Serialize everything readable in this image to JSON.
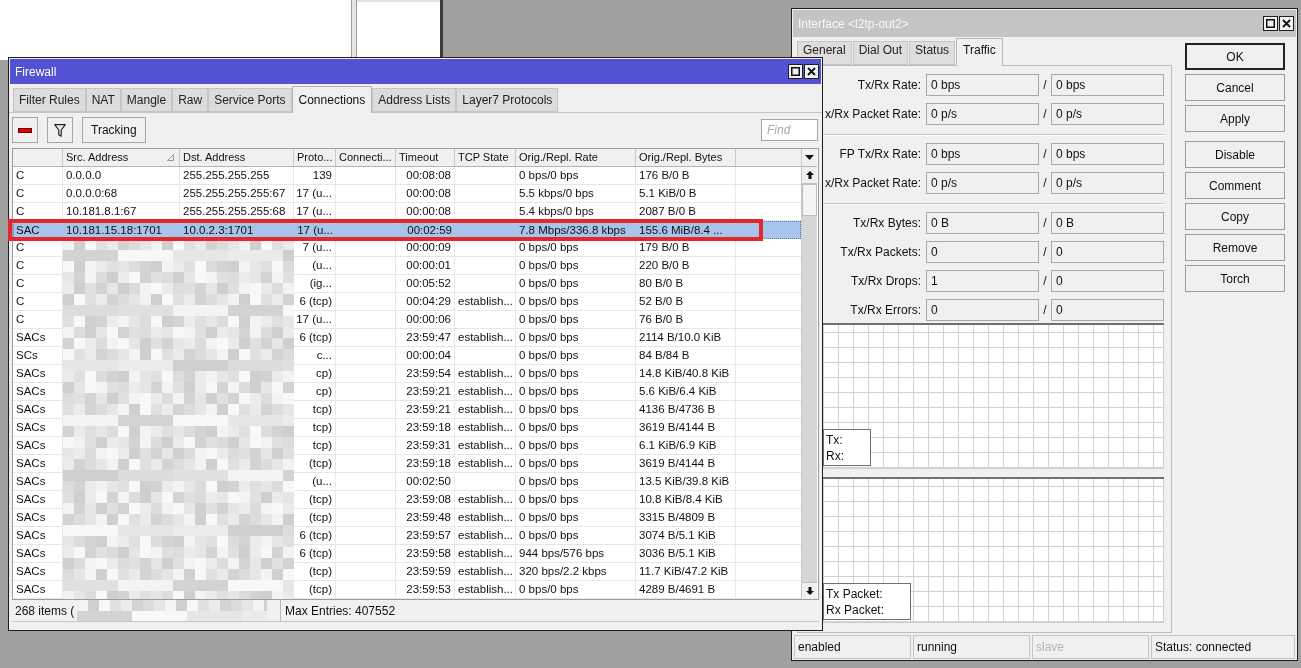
{
  "interface_window": {
    "title": "Interface <l2tp-out2>",
    "active": false,
    "tabs": [
      {
        "label": "General",
        "selected": false
      },
      {
        "label": "Dial Out",
        "selected": false
      },
      {
        "label": "Status",
        "selected": false
      },
      {
        "label": "Traffic",
        "selected": true
      }
    ],
    "field_groups": [
      [
        {
          "label": "Tx/Rx Rate:",
          "tx": "0 bps",
          "separator": "/",
          "rx": "0 bps"
        },
        {
          "label": "x/Rx Packet Rate:",
          "tx": "0 p/s",
          "separator": "/",
          "rx": "0 p/s"
        }
      ],
      [
        {
          "label": "FP Tx/Rx Rate:",
          "tx": "0 bps",
          "separator": "/",
          "rx": "0 bps"
        },
        {
          "label": "x/Rx Packet Rate:",
          "tx": "0 p/s",
          "separator": "/",
          "rx": "0 p/s"
        }
      ],
      [
        {
          "label": "Tx/Rx Bytes:",
          "tx": "0 B",
          "separator": "/",
          "rx": "0 B"
        },
        {
          "label": "Tx/Rx Packets:",
          "tx": "0",
          "separator": "/",
          "rx": "0"
        },
        {
          "label": "Tx/Rx Drops:",
          "tx": "1",
          "separator": "/",
          "rx": "0"
        },
        {
          "label": "Tx/Rx Errors:",
          "tx": "0",
          "separator": "/",
          "rx": "0"
        }
      ]
    ],
    "graphs": [
      {
        "legend": [
          "Tx:",
          "Rx:"
        ]
      },
      {
        "legend": [
          "Tx Packet:",
          "Rx Packet:"
        ]
      }
    ],
    "button_groups": [
      [
        {
          "label": "OK",
          "default": true
        },
        {
          "label": "Cancel",
          "default": false
        },
        {
          "label": "Apply",
          "default": false
        }
      ],
      [
        {
          "label": "Disable",
          "default": false
        },
        {
          "label": "Comment",
          "default": false
        },
        {
          "label": "Copy",
          "default": false
        },
        {
          "label": "Remove",
          "default": false
        },
        {
          "label": "Torch",
          "default": false
        }
      ]
    ],
    "status_bar": [
      {
        "text": "enabled",
        "disabled": false
      },
      {
        "text": "running",
        "disabled": false
      },
      {
        "text": "slave",
        "disabled": true
      },
      {
        "text": "Status: connected",
        "disabled": false
      }
    ]
  },
  "firewall_window": {
    "title": "Firewall",
    "active": true,
    "tabs": [
      {
        "label": "Filter Rules",
        "selected": false
      },
      {
        "label": "NAT",
        "selected": false
      },
      {
        "label": "Mangle",
        "selected": false
      },
      {
        "label": "Raw",
        "selected": false
      },
      {
        "label": "Service Ports",
        "selected": false
      },
      {
        "label": "Connections",
        "selected": true
      },
      {
        "label": "Address Lists",
        "selected": false
      },
      {
        "label": "Layer7 Protocols",
        "selected": false
      }
    ],
    "toolbar": {
      "buttons": [
        {
          "kind": "remove"
        },
        {
          "kind": "filter"
        },
        {
          "kind": "text",
          "label": "Tracking"
        }
      ],
      "find": {
        "placeholder": "Find"
      }
    },
    "table": {
      "columns": [
        {
          "label": "Src. Address",
          "sorted": true
        },
        {
          "label": "Dst. Address",
          "sorted": false
        },
        {
          "label": "Proto...",
          "sorted": false
        },
        {
          "label": "Connecti...",
          "sorted": false
        },
        {
          "label": "Timeout",
          "sorted": false
        },
        {
          "label": "TCP State",
          "sorted": false
        },
        {
          "label": "Orig./Repl. Rate",
          "sorted": false
        },
        {
          "label": "Orig./Repl. Bytes",
          "sorted": false
        }
      ],
      "rows": [
        {
          "flags": "C",
          "src_address": "0.0.0.0",
          "dst_address": "255.255.255.255",
          "protocol": "139",
          "timeout": "00:08:08",
          "rate": "0 bps/0 bps",
          "bytes": "176 B/0 B",
          "selected": false
        },
        {
          "flags": "C",
          "src_address": "0.0.0.0:68",
          "dst_address": "255.255.255.255:67",
          "protocol": "17 (u...",
          "timeout": "00:00:08",
          "rate": "5.5 kbps/0 bps",
          "bytes": "5.1 KiB/0 B",
          "selected": false
        },
        {
          "flags": "C",
          "src_address": "10.181.8.1:67",
          "dst_address": "255.255.255.255:68",
          "protocol": "17 (u...",
          "timeout": "00:00:08",
          "rate": "5.4 kbps/0 bps",
          "bytes": "2087 B/0 B",
          "selected": false
        },
        {
          "flags": "SAC",
          "src_address": "10.181.15.18:1701",
          "dst_address": "10.0.2.3:1701",
          "protocol": "17 (u...",
          "timeout": "00:02:59",
          "rate": "7.8 Mbps/336.8 kbps",
          "bytes": "155.6 MiB/8.4 ...",
          "selected": true
        },
        {
          "flags": "C",
          "protocol": "7 (u...",
          "timeout": "00:00:09",
          "rate": "0 bps/0 bps",
          "bytes": "179 B/0 B",
          "selected": false
        },
        {
          "flags": "C",
          "protocol": "(u...",
          "timeout": "00:00:01",
          "rate": "0 bps/0 bps",
          "bytes": "220 B/0 B",
          "selected": false
        },
        {
          "flags": "C",
          "protocol": "(ig...",
          "timeout": "00:05:52",
          "rate": "0 bps/0 bps",
          "bytes": "80 B/0 B",
          "selected": false
        },
        {
          "flags": "C",
          "protocol": "6 (tcp)",
          "timeout": "00:04:29",
          "tcp_state": "establish...",
          "rate": "0 bps/0 bps",
          "bytes": "52 B/0 B",
          "selected": false
        },
        {
          "flags": "C",
          "protocol": "17 (u...",
          "timeout": "00:00:06",
          "rate": "0 bps/0 bps",
          "bytes": "76 B/0 B",
          "selected": false
        },
        {
          "flags": "SACs",
          "protocol": "6 (tcp)",
          "timeout": "23:59:47",
          "tcp_state": "establish...",
          "rate": "0 bps/0 bps",
          "bytes": "2114 B/10.0 KiB",
          "selected": false
        },
        {
          "flags": "SCs",
          "protocol": "c...",
          "timeout": "00:00:04",
          "rate": "0 bps/0 bps",
          "bytes": "84 B/84 B",
          "selected": false
        },
        {
          "flags": "SACs",
          "protocol": "cp)",
          "timeout": "23:59:54",
          "tcp_state": "establish...",
          "rate": "0 bps/0 bps",
          "bytes": "14.8 KiB/40.8 KiB",
          "selected": false
        },
        {
          "flags": "SACs",
          "protocol": "cp)",
          "timeout": "23:59:21",
          "tcp_state": "establish...",
          "rate": "0 bps/0 bps",
          "bytes": "5.6 KiB/6.4 KiB",
          "selected": false
        },
        {
          "flags": "SACs",
          "protocol": "tcp)",
          "timeout": "23:59:21",
          "tcp_state": "establish...",
          "rate": "0 bps/0 bps",
          "bytes": "4136 B/4736 B",
          "selected": false
        },
        {
          "flags": "SACs",
          "protocol": "tcp)",
          "timeout": "23:59:18",
          "tcp_state": "establish...",
          "rate": "0 bps/0 bps",
          "bytes": "3619 B/4144 B",
          "selected": false
        },
        {
          "flags": "SACs",
          "protocol": "tcp)",
          "timeout": "23:59:31",
          "tcp_state": "establish...",
          "rate": "0 bps/0 bps",
          "bytes": "6.1 KiB/6.9 KiB",
          "selected": false
        },
        {
          "flags": "SACs",
          "protocol": "(tcp)",
          "timeout": "23:59:18",
          "tcp_state": "establish...",
          "rate": "0 bps/0 bps",
          "bytes": "3619 B/4144 B",
          "selected": false
        },
        {
          "flags": "SACs",
          "protocol": "(u...",
          "timeout": "00:02:50",
          "rate": "0 bps/0 bps",
          "bytes": "13.5 KiB/39.8 KiB",
          "selected": false
        },
        {
          "flags": "SACs",
          "protocol": "(tcp)",
          "timeout": "23:59:08",
          "tcp_state": "establish...",
          "rate": "0 bps/0 bps",
          "bytes": "10.8 KiB/8.4 KiB",
          "selected": false
        },
        {
          "flags": "SACs",
          "protocol": "(tcp)",
          "timeout": "23:59:48",
          "tcp_state": "establish...",
          "rate": "0 bps/0 bps",
          "bytes": "3315 B/4809 B",
          "selected": false
        },
        {
          "flags": "SACs",
          "protocol": "6 (tcp)",
          "timeout": "23:59:57",
          "tcp_state": "establish...",
          "rate": "0 bps/0 bps",
          "bytes": "3074 B/5.1 KiB",
          "selected": false
        },
        {
          "flags": "SACs",
          "protocol": "6 (tcp)",
          "timeout": "23:59:58",
          "tcp_state": "establish...",
          "rate": "944 bps/576 bps",
          "bytes": "3036 B/5.1 KiB",
          "selected": false
        },
        {
          "flags": "SACs",
          "protocol": "(tcp)",
          "timeout": "23:59:59",
          "tcp_state": "establish...",
          "rate": "320 bps/2.2 kbps",
          "bytes": "11.7 KiB/47.2 KiB",
          "selected": false
        },
        {
          "flags": "SACs",
          "protocol": "(tcp)",
          "timeout": "23:59:53",
          "tcp_state": "establish...",
          "rate": "0 bps/0 bps",
          "bytes": "4289 B/4691 B",
          "selected": false
        }
      ]
    },
    "status_bar": [
      "268 items (",
      "Max Entries: 407552"
    ]
  }
}
